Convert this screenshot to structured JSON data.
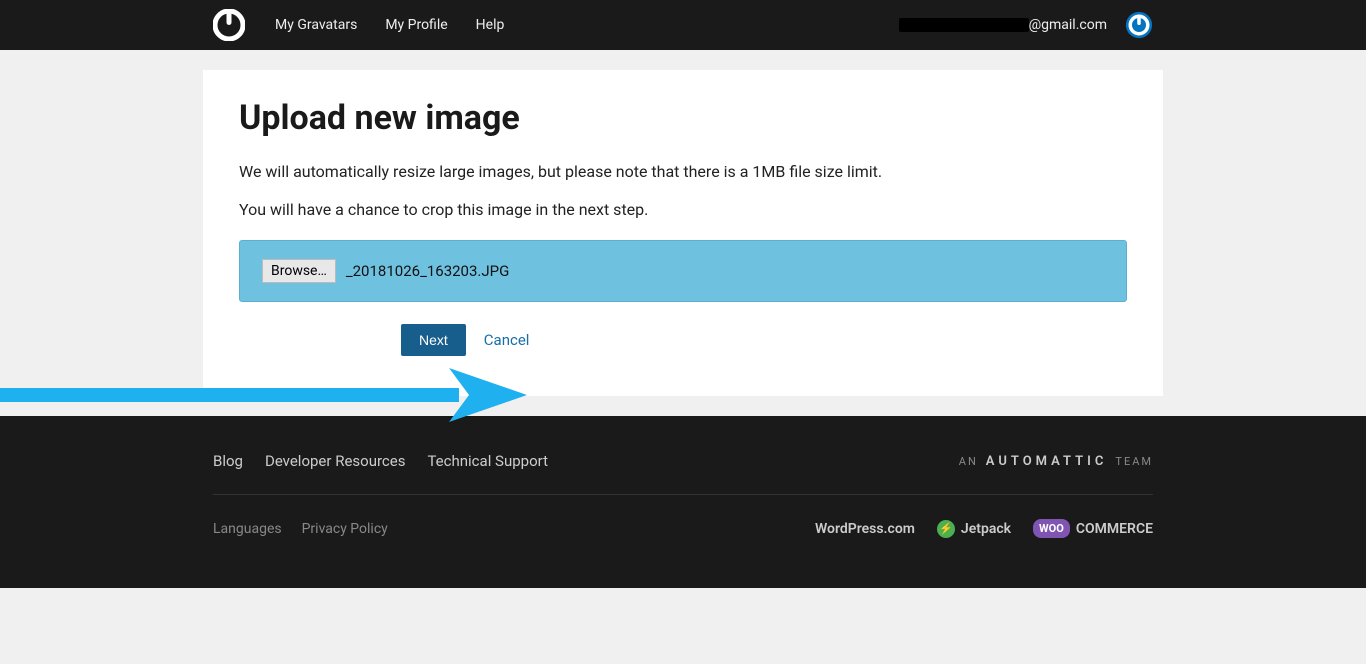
{
  "header": {
    "nav": [
      "My Gravatars",
      "My Profile",
      "Help"
    ],
    "user_email_suffix": "@gmail.com"
  },
  "page": {
    "title": "Upload new image",
    "desc1": "We will automatically resize large images, but please note that there is a 1MB file size limit.",
    "desc2": "You will have a chance to crop this image in the next step.",
    "browse_label": "Browse…",
    "selected_file": "_20181026_163203.JPG",
    "next_label": "Next",
    "cancel_label": "Cancel"
  },
  "footer": {
    "links1": [
      "Blog",
      "Developer Resources",
      "Technical Support"
    ],
    "tag_prefix": "AN",
    "tag_brand": "AUTOMATTIC",
    "tag_suffix": "TEAM",
    "links2": [
      "Languages",
      "Privacy Policy"
    ],
    "brands": {
      "wordpress": "WordPress.com",
      "jetpack": "Jetpack",
      "woo_prefix": "WOO",
      "woo_suffix": "COMMERCE"
    }
  }
}
